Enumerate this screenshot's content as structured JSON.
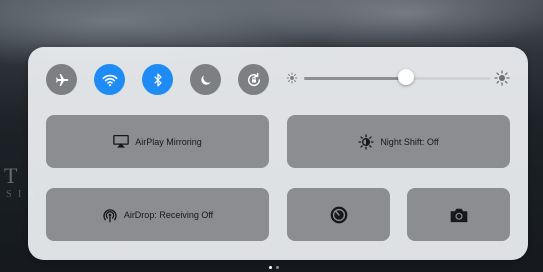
{
  "background": {
    "title_fragment": "T",
    "subtitle_fragment": "S I N"
  },
  "toggles": [
    {
      "name": "airplane-mode",
      "icon": "airplane-icon",
      "state": "off"
    },
    {
      "name": "wifi",
      "icon": "wifi-icon",
      "state": "on"
    },
    {
      "name": "bluetooth",
      "icon": "bluetooth-icon",
      "state": "on"
    },
    {
      "name": "do-not-disturb",
      "icon": "moon-icon",
      "state": "off"
    },
    {
      "name": "rotation-lock",
      "icon": "rotation-lock-icon",
      "state": "off"
    }
  ],
  "brightness": {
    "level": 0.55
  },
  "buttons": {
    "airplay": "AirPlay Mirroring",
    "night_shift": "Night Shift: Off",
    "airdrop": "AirDrop: Receiving Off"
  },
  "shortcuts": [
    {
      "name": "timer",
      "icon": "timer-icon"
    },
    {
      "name": "camera",
      "icon": "camera-icon"
    }
  ],
  "page_indicator": {
    "pages": 2,
    "current": 1
  },
  "colors": {
    "accent": "#1f8bf5",
    "toggle_off": "#7d7f83",
    "tile": "#8b8d90",
    "panel": "#eef0f3"
  }
}
